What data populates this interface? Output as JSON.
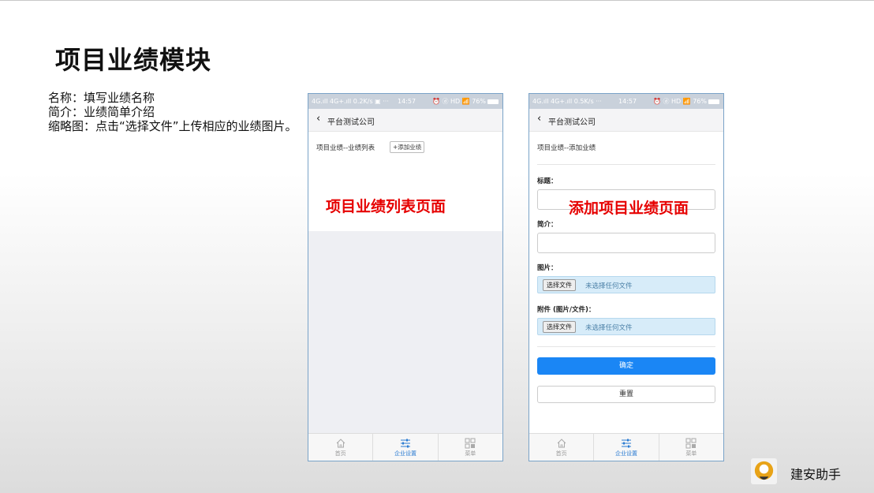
{
  "slide": {
    "title": "项目业绩模块",
    "desc_name": "名称：填写业绩名称",
    "desc_intro": "简介：业绩简单介绍",
    "desc_thumb": "缩略图：点击“选择文件”上传相应的业绩图片。"
  },
  "phone_left": {
    "status": {
      "signal": "4G.ıll 4G+.ıll 0.2K/s ▣ ···",
      "time": "14:57",
      "right": "⏰ ⓓ HD 📶 76%"
    },
    "nav": {
      "back": "‹",
      "title": "平台测试公司"
    },
    "list_title": "项目业绩--业绩列表",
    "add_button": "+添加业绩",
    "overlay": "项目业绩列表页面",
    "tabs": [
      {
        "icon": "home-icon",
        "label": "首页",
        "active": false
      },
      {
        "icon": "settings-sliders-icon",
        "label": "企业设置",
        "active": true
      },
      {
        "icon": "menu-grid-icon",
        "label": "菜单",
        "active": false
      }
    ]
  },
  "phone_right": {
    "status": {
      "signal": "4G.ıll 4G+.ıll 0.5K/s ···",
      "time": "14:57",
      "right": "⏰ ⓓ HD 📶 76%"
    },
    "nav": {
      "back": "‹",
      "title": "平台测试公司"
    },
    "form_title": "项目业绩--添加业绩",
    "overlay": "添加项目业绩页面",
    "fields": {
      "title_label": "标题：",
      "intro_label": "简介：",
      "image_label": "图片：",
      "attach_label": "附件 (图片/文件)："
    },
    "file_button": "选择文件",
    "file_none": "未选择任何文件",
    "confirm_button": "确定",
    "reset_button": "重置",
    "tabs": [
      {
        "icon": "home-icon",
        "label": "首页",
        "active": false
      },
      {
        "icon": "settings-sliders-icon",
        "label": "企业设置",
        "active": true
      },
      {
        "icon": "menu-grid-icon",
        "label": "菜单",
        "active": false
      }
    ]
  },
  "brand": {
    "name": "建安助手"
  },
  "colors": {
    "accent_red": "#e60000",
    "primary_blue": "#1a86f5",
    "tab_active": "#2a7bd2"
  }
}
